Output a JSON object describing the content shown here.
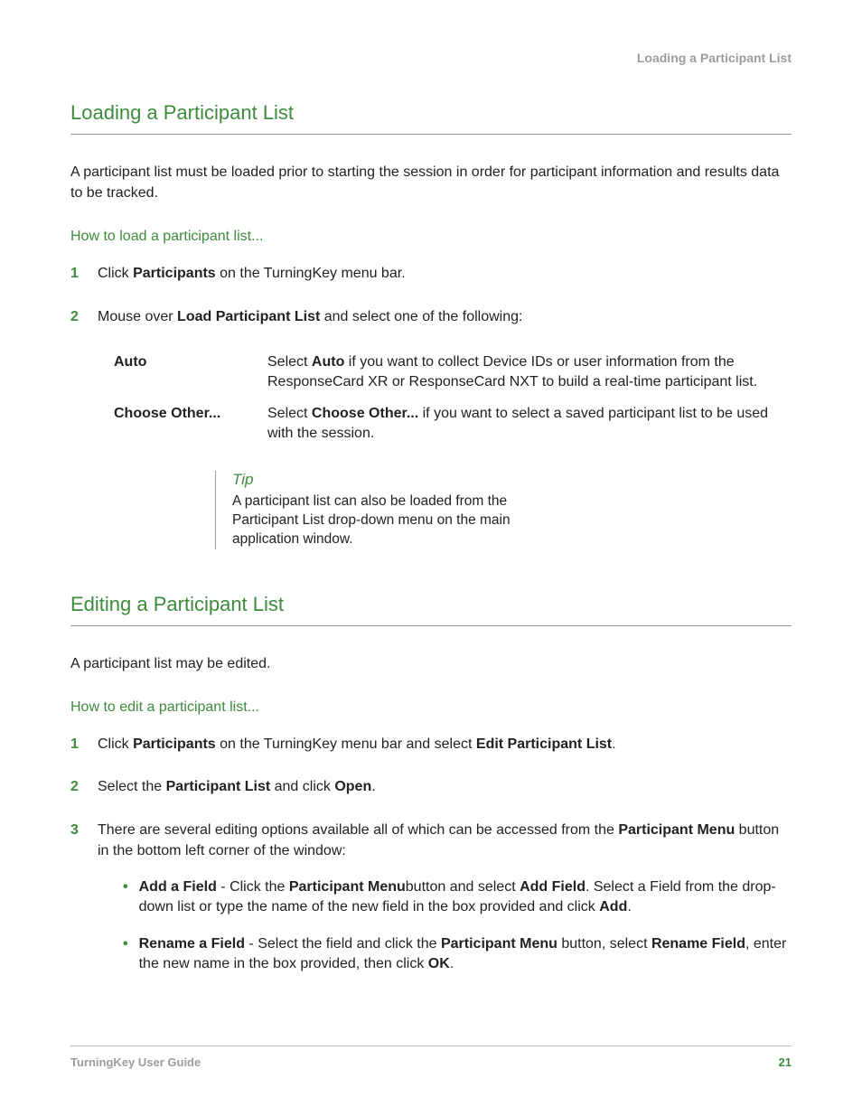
{
  "runningHeader": "Loading a Participant List",
  "section1": {
    "heading": "Loading a Participant List",
    "intro": "A participant list must be loaded prior to starting the session in order for participant information and results data to be tracked.",
    "howto": "How to load a participant list...",
    "step1": {
      "num": "1",
      "pre": "Click ",
      "b1": "Participants",
      "post": " on the TurningKey menu bar."
    },
    "step2": {
      "num": "2",
      "pre": "Mouse over ",
      "b1": "Load Participant List",
      "post": " and select one of the following:"
    },
    "optAuto": {
      "label": "Auto",
      "pre": "Select ",
      "b1": "Auto",
      "post": " if you want to collect Device IDs or user information from the ResponseCard XR or ResponseCard NXT to build a real-time participant list."
    },
    "optChoose": {
      "label": "Choose Other...",
      "pre": "Select ",
      "b1": "Choose Other...",
      "post": " if you want to select a saved participant list to be used with the session."
    },
    "tip": {
      "title": "Tip",
      "text": "A participant list can also be loaded from the Participant List drop-down menu on the main application window."
    }
  },
  "section2": {
    "heading": "Editing a Participant List",
    "intro": "A participant list may be edited.",
    "howto": "How to edit a participant list...",
    "step1": {
      "num": "1",
      "pre": "Click ",
      "b1": "Participants",
      "mid": " on the TurningKey menu bar and select ",
      "b2": "Edit Participant List",
      "post": "."
    },
    "step2": {
      "num": "2",
      "pre": "Select the ",
      "b1": "Participant List",
      "mid": " and click ",
      "b2": "Open",
      "post": "."
    },
    "step3": {
      "num": "3",
      "pre": "There are several editing options available all of which can be accessed from the ",
      "b1": "Participant Menu",
      "post": " button in the bottom left corner of the window:"
    },
    "bullet1": {
      "b1": "Add a Field",
      "t1": " - Click the ",
      "b2": "Participant Menu",
      "t2": "button and select ",
      "b3": "Add Field",
      "t3": ". Select a Field from the drop-down list or type the name of the new field in the box provided and click ",
      "b4": "Add",
      "t4": "."
    },
    "bullet2": {
      "b1": "Rename a Field",
      "t1": " - Select the field and click the ",
      "b2": "Participant Menu",
      "t2": " button, select ",
      "b3": "Rename Field",
      "t3": ", enter the new name in the box provided, then click ",
      "b4": "OK",
      "t4": "."
    }
  },
  "footer": {
    "left": "TurningKey User Guide",
    "right": "21"
  }
}
